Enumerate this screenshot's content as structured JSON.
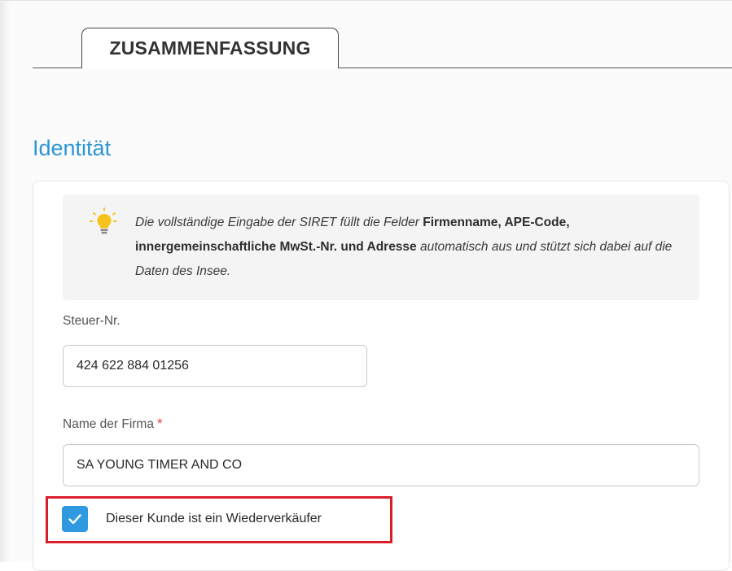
{
  "tabs": [
    {
      "label": "ZUSAMMENFASSUNG",
      "active": true
    }
  ],
  "section": {
    "title": "Identität"
  },
  "info": {
    "icon": "lightbulb-icon",
    "part1": "Die vollständige Eingabe der SIRET füllt die Felder ",
    "bold": "Firmenname, APE-Code, innergemeinschaftliche MwSt.-Nr. und Adresse",
    "part2": " automatisch aus und stützt sich dabei auf die Daten des Insee."
  },
  "fields": {
    "siret": {
      "label": "Steuer-Nr.",
      "value": "424 622 884 01256"
    },
    "company_name": {
      "label": "Name der Firma",
      "required_mark": "*",
      "value": "SA YOUNG TIMER AND CO"
    }
  },
  "reseller_checkbox": {
    "label": "Dieser Kunde ist ein Wiederverkäufer",
    "checked": true
  },
  "colors": {
    "accent": "#2c95d6",
    "checkbox": "#2f9ae0",
    "required": "#e0443a",
    "highlight": "#d91e2a",
    "bulb": "#f7c21c"
  }
}
